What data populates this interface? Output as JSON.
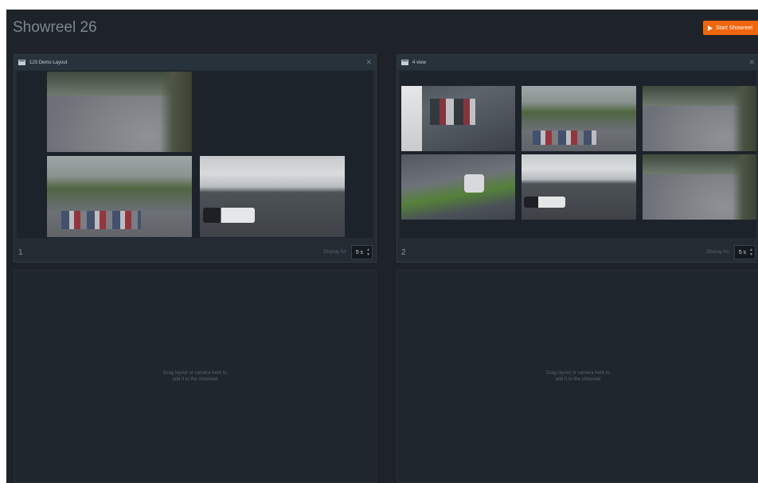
{
  "showreel": {
    "title": "Showreel 26",
    "start_label": "Start Showreel"
  },
  "panels": [
    {
      "title": "123 Demo Layout",
      "close_icon": "close-icon",
      "number": "1",
      "display_label": "Display for",
      "duration_value": "5 s"
    },
    {
      "title": "4 view",
      "close_icon": "close-icon",
      "number": "2",
      "display_label": "Display for",
      "duration_value": "5 s"
    }
  ],
  "empty_slots": [
    {
      "text": "Drag layout or camera here to add it to the showreel"
    },
    {
      "text": "Drag layout or camera here to add it to the showreel"
    }
  ],
  "colors": {
    "accent": "#f0660c",
    "background": "#1e2329",
    "panel": "#242b33"
  }
}
